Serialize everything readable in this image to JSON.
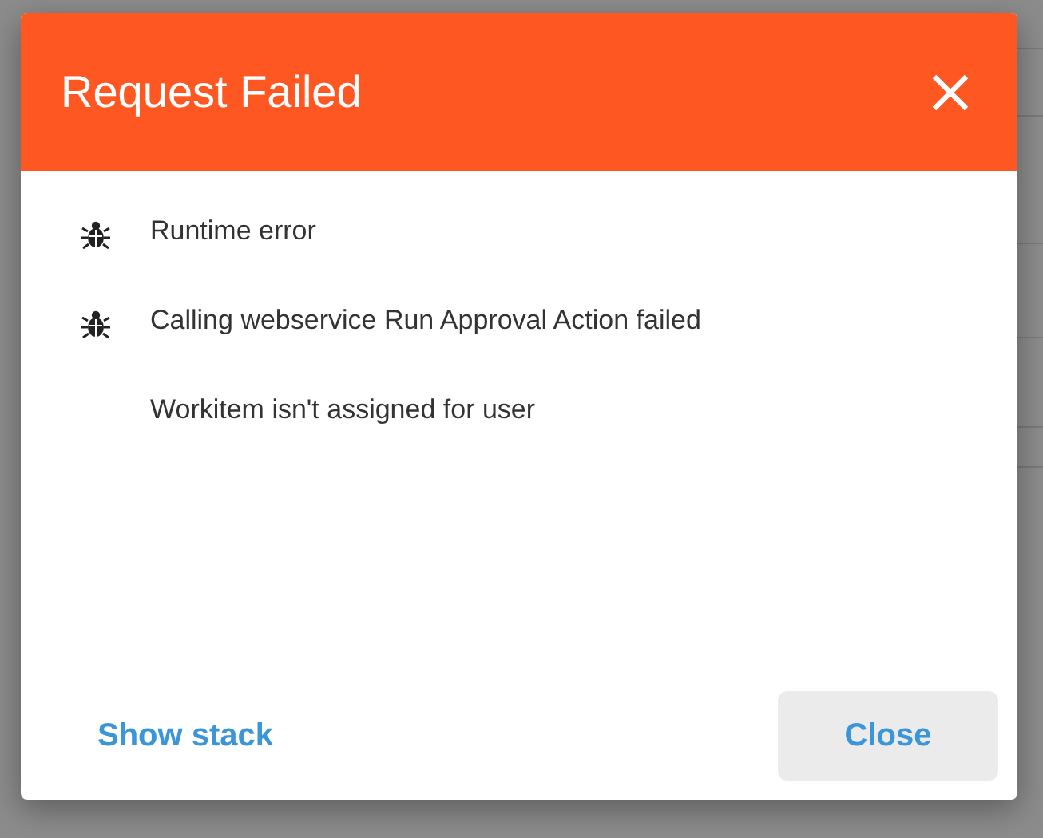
{
  "dialog": {
    "title": "Request Failed",
    "messages": [
      {
        "kind": "error",
        "text": "Runtime error"
      },
      {
        "kind": "error",
        "text": "Calling webservice Run Approval Action failed"
      },
      {
        "kind": "detail",
        "text": "Workitem isn't assigned for user"
      }
    ],
    "link": "Show stack",
    "button": "Close"
  }
}
